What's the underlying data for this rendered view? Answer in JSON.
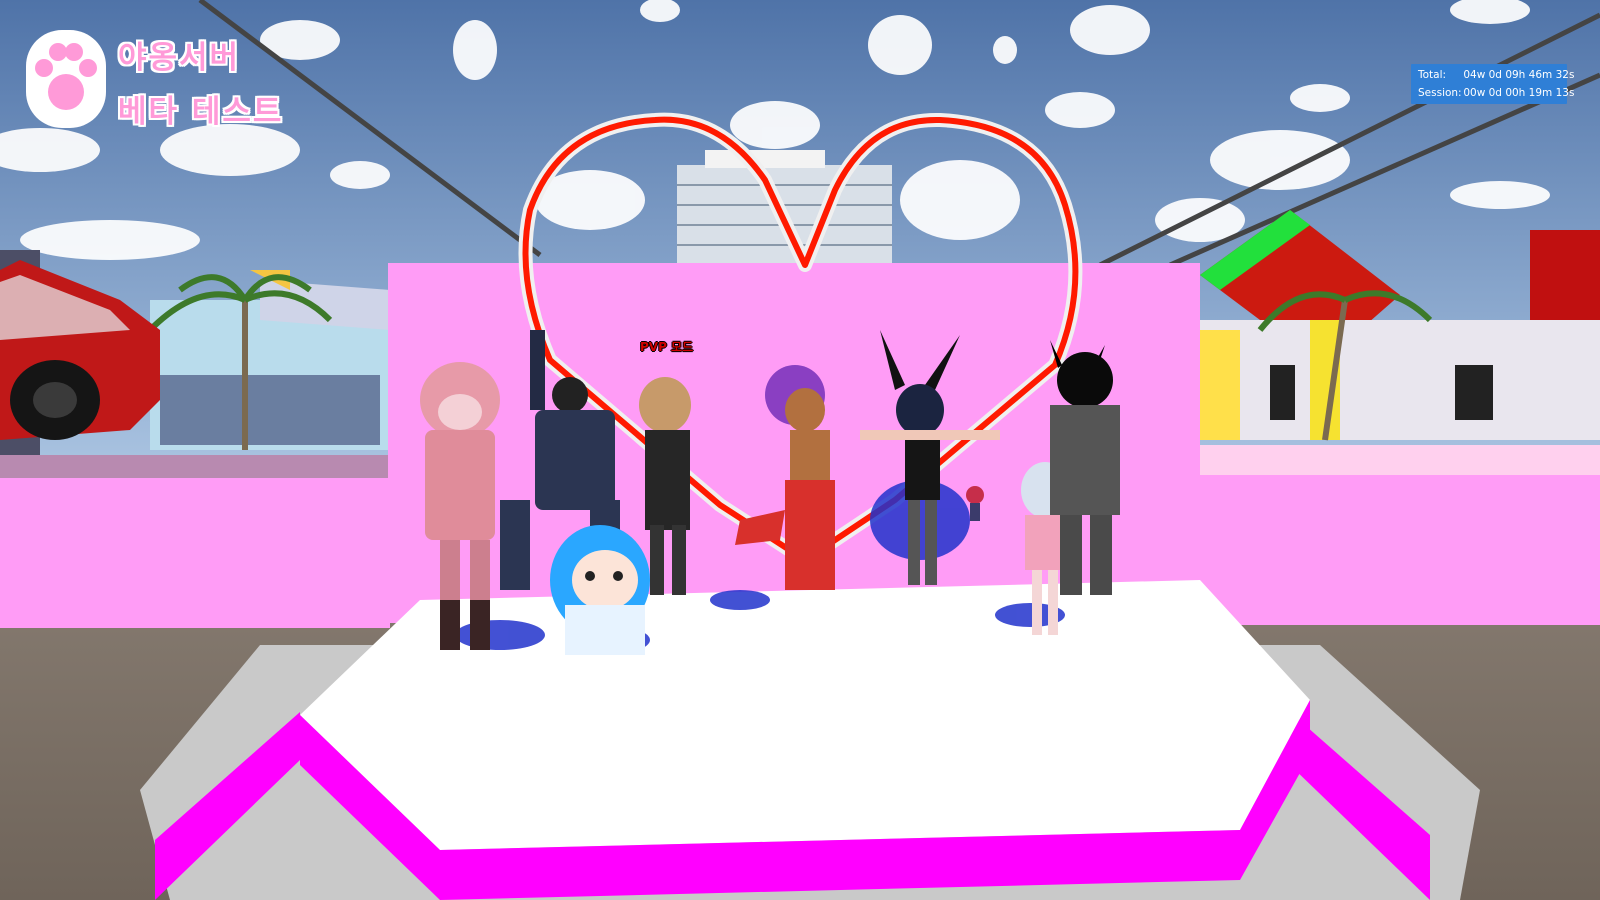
{
  "server": {
    "title_line1": "야옹서버",
    "title_line2": "베타 테스트",
    "logo_icon": "paw-icon"
  },
  "timer": {
    "total_label": "Total:",
    "total_value": "04w 0d 09h 46m 32s",
    "session_label": "Session:",
    "session_value": "00w 0d 00h 19m 13s"
  },
  "player_nametag": "PVP 모드",
  "colors": {
    "pink_wall": "#ff9cf6",
    "stage_white": "#ffffff",
    "stage_magenta": "#ff00ff",
    "heart_red": "#ff1a00",
    "hud_box": "#2f7fd6",
    "title_pink": "#ff9ad8"
  }
}
